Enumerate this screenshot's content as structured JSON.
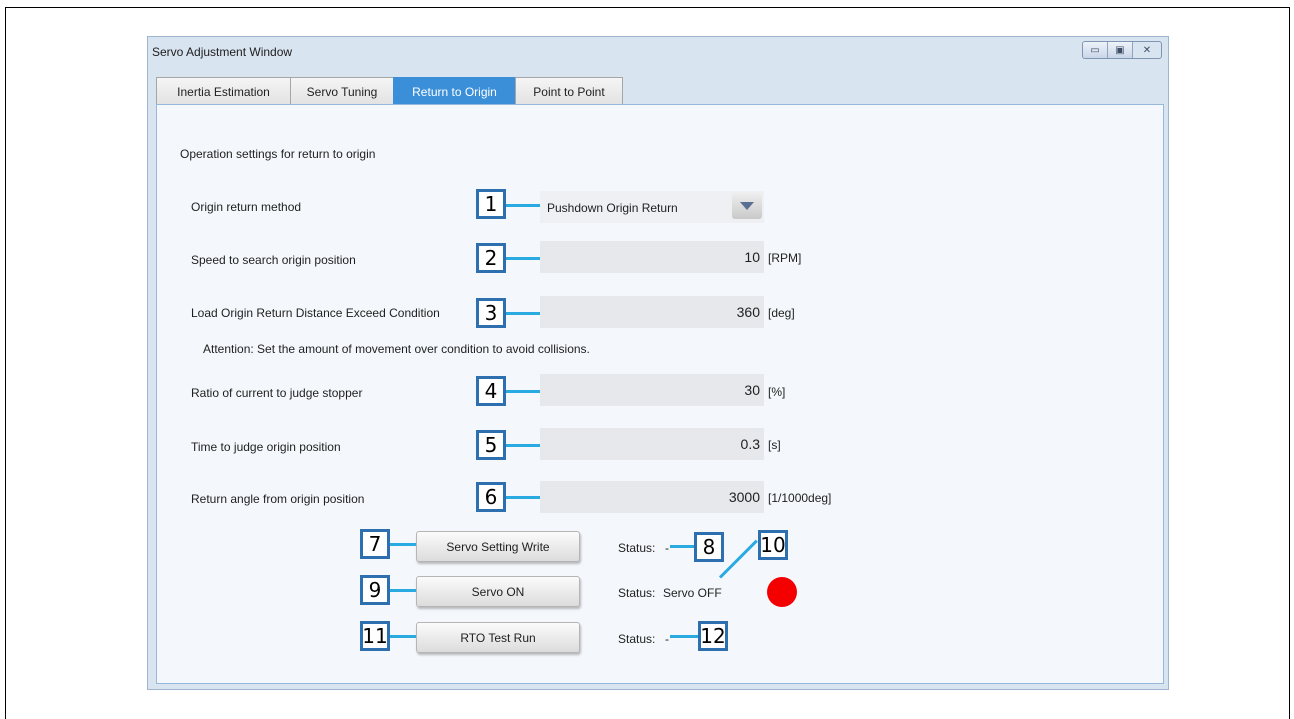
{
  "window": {
    "title": "Servo Adjustment Window",
    "controls": {
      "minimize": "▭",
      "maximize": "▣",
      "close": "✕"
    }
  },
  "tabs": [
    {
      "label": "Inertia Estimation",
      "active": false
    },
    {
      "label": "Servo Tuning",
      "active": false
    },
    {
      "label": "Return to Origin",
      "active": true
    },
    {
      "label": "Point to Point",
      "active": false
    }
  ],
  "section_title": "Operation settings for return to origin",
  "settings": {
    "origin_method": {
      "label": "Origin return method",
      "value": "Pushdown Origin Return",
      "callout": "1"
    },
    "search_speed": {
      "label": "Speed to search origin position",
      "value": "10",
      "unit": "[RPM]",
      "callout": "2"
    },
    "exceed_condition": {
      "label": "Load Origin Return Distance Exceed Condition",
      "value": "360",
      "unit": "[deg]",
      "callout": "3"
    },
    "attention": "Attention: Set the amount of movement over condition to avoid collisions.",
    "current_ratio": {
      "label": "Ratio of current to judge stopper",
      "value": "30",
      "unit": "[%]",
      "callout": "4"
    },
    "judge_time": {
      "label": "Time to judge origin position",
      "value": "0.3",
      "unit": "[s]",
      "callout": "5"
    },
    "return_angle": {
      "label": "Return angle from origin position",
      "value": "3000",
      "unit": "[1/1000deg]",
      "callout": "6"
    }
  },
  "actions": {
    "servo_write": {
      "label": "Servo Setting Write",
      "callout": "7",
      "status_label": "Status:",
      "status_value": "-",
      "status_callout": "8"
    },
    "servo_on": {
      "label": "Servo ON",
      "callout": "9",
      "status_label": "Status:",
      "status_value": "Servo OFF",
      "status_callout": "10",
      "led_color": "#f40000"
    },
    "rto_test": {
      "label": "RTO Test Run",
      "callout": "11",
      "status_label": "Status:",
      "status_value": "-",
      "status_callout": "12"
    }
  },
  "colors": {
    "accent": "#3a8fd8",
    "callout_border": "#2e6fb0",
    "callout_line": "#29aae1"
  }
}
